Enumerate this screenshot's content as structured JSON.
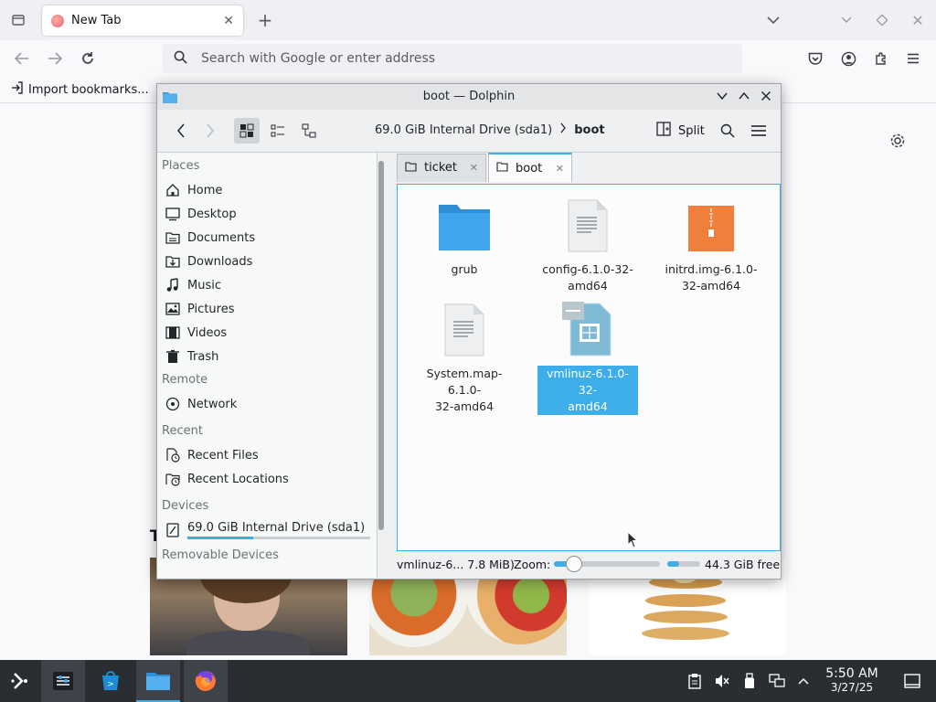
{
  "firefox": {
    "tab_title": "New Tab",
    "url_placeholder": "Search with Google or enter address",
    "bookmark_import": "Import bookmarks..."
  },
  "dolphin": {
    "title": "boot — Dolphin",
    "breadcrumb": {
      "drive": "69.0 GiB Internal Drive (sda1)",
      "current": "boot"
    },
    "split_label": "Split",
    "tabs": [
      {
        "label": "ticket"
      },
      {
        "label": "boot"
      }
    ],
    "sidebar": {
      "places_title": "Places",
      "places": [
        {
          "label": "Home",
          "icon": "home-icon"
        },
        {
          "label": "Desktop",
          "icon": "desktop-icon"
        },
        {
          "label": "Documents",
          "icon": "documents-icon"
        },
        {
          "label": "Downloads",
          "icon": "downloads-icon"
        },
        {
          "label": "Music",
          "icon": "music-icon"
        },
        {
          "label": "Pictures",
          "icon": "pictures-icon"
        },
        {
          "label": "Videos",
          "icon": "videos-icon"
        },
        {
          "label": "Trash",
          "icon": "trash-icon"
        }
      ],
      "remote_title": "Remote",
      "remote": [
        {
          "label": "Network",
          "icon": "network-icon"
        }
      ],
      "recent_title": "Recent",
      "recent": [
        {
          "label": "Recent Files",
          "icon": "recent-files-icon"
        },
        {
          "label": "Recent Locations",
          "icon": "recent-locations-icon"
        }
      ],
      "devices_title": "Devices",
      "devices": [
        {
          "label": "69.0 GiB Internal Drive (sda1)",
          "icon": "drive-icon",
          "usage": 0.36
        }
      ],
      "removable_title": "Removable Devices"
    },
    "files": [
      {
        "name_lines": [
          "grub",
          ""
        ],
        "kind": "folder"
      },
      {
        "name_lines": [
          "config-6.1.0-32-",
          "amd64"
        ],
        "kind": "text"
      },
      {
        "name_lines": [
          "initrd.img-6.1.0-",
          "32-amd64"
        ],
        "kind": "archive"
      },
      {
        "name_lines": [
          "System.map-6.1.0-",
          "32-amd64"
        ],
        "kind": "text"
      },
      {
        "name_lines": [
          "vmlinuz-6.1.0-32-",
          "amd64"
        ],
        "kind": "binary",
        "selected": true
      }
    ],
    "status": {
      "selection_info": "vmlinuz-6... 7.8 MiB)",
      "zoom_label": "Zoom:",
      "zoom_level": 0.18,
      "free_space": "44.3 GiB free",
      "free_fraction": 0.35
    }
  },
  "taskbar": {
    "clock_time": "5:50 AM",
    "clock_date": "3/27/25"
  },
  "colors": {
    "accent": "#3daee9",
    "folder": "#3d9ee8",
    "archive": "#f07f3c"
  }
}
